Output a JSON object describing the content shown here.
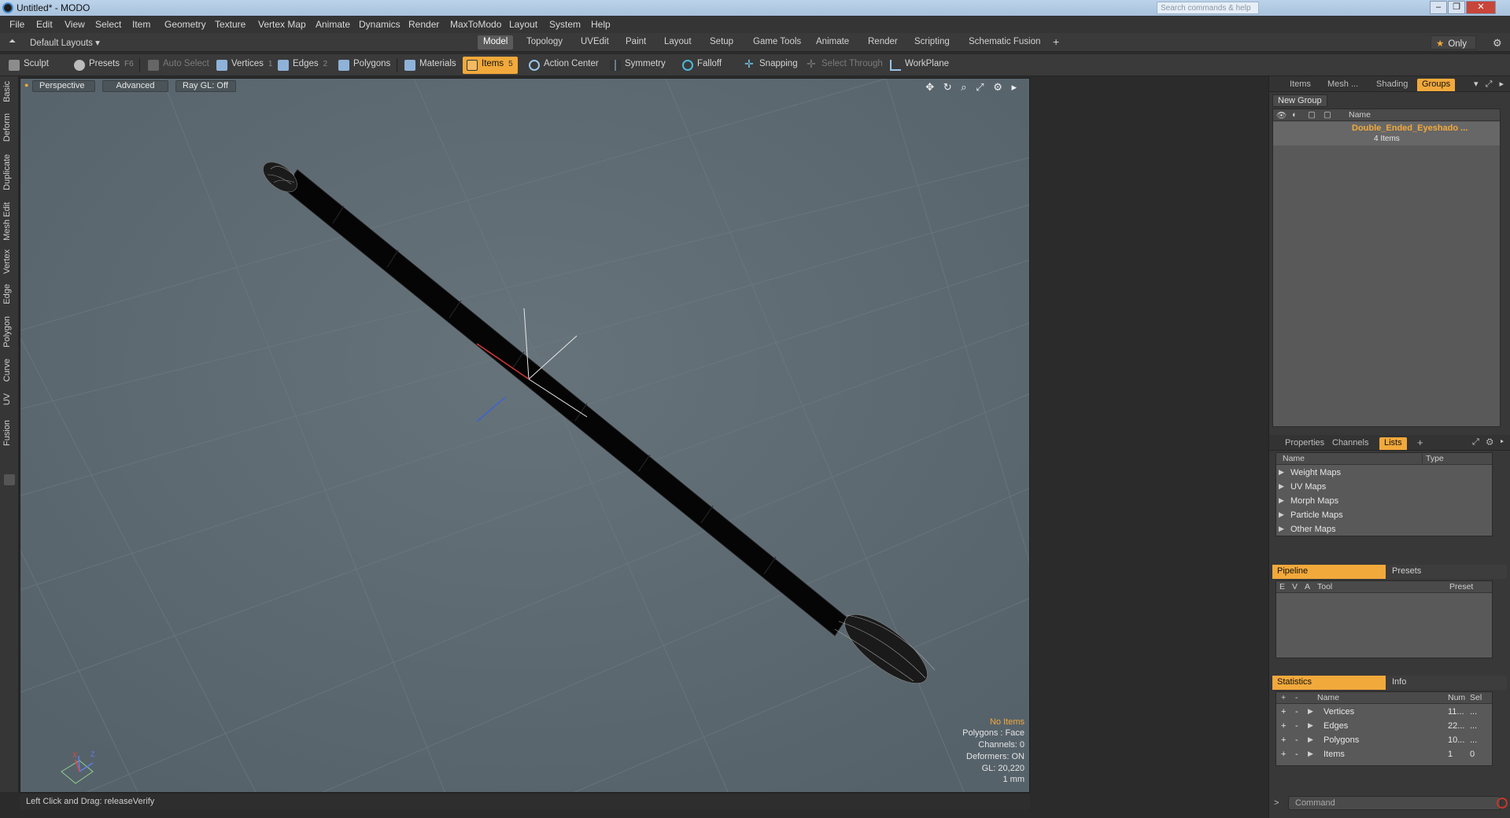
{
  "titlebar": {
    "title": "Untitled* - MODO",
    "search_placeholder": "Search commands & help",
    "min": "–",
    "max": "❐",
    "close": "✕"
  },
  "menu": [
    "File",
    "Edit",
    "View",
    "Select",
    "Item",
    "Geometry",
    "Texture",
    "Vertex Map",
    "Animate",
    "Dynamics",
    "Render",
    "MaxToModo",
    "Layout",
    "System",
    "Help"
  ],
  "layout_row": {
    "layout_selector": "Default Layouts ▾",
    "tabs": [
      "Model",
      "Topology",
      "UVEdit",
      "Paint",
      "Layout",
      "Setup",
      "Game Tools",
      "Animate",
      "Render",
      "Scripting",
      "Schematic Fusion"
    ],
    "active_tab": "Model",
    "add_tab": "+",
    "only_label": "Only",
    "gear": "⚙"
  },
  "toolbar": {
    "sculpt": "Sculpt",
    "presets": "Presets",
    "presets_key": "F6",
    "auto_select": "Auto Select",
    "vertices": "Vertices",
    "vertices_key": "1",
    "edges": "Edges",
    "edges_key": "2",
    "polygons": "Polygons",
    "materials": "Materials",
    "items": "Items",
    "items_key": "5",
    "action_center": "Action Center",
    "symmetry": "Symmetry",
    "falloff": "Falloff",
    "snapping": "Snapping",
    "select_through": "Select Through",
    "workplane": "WorkPlane"
  },
  "left_tabs": [
    "Basic",
    "Deform",
    "Duplicate",
    "Mesh Edit",
    "Vertex",
    "Edge",
    "Polygon",
    "Curve",
    "UV",
    "Fusion"
  ],
  "viewport": {
    "view_mode": "Perspective",
    "shading": "Advanced",
    "raygl": "Ray GL: Off",
    "icons": "✥ ↻ ⌕ ⤢ ⚙ ▸",
    "info": {
      "selection": "No Items",
      "polygons": "Polygons : Face",
      "channels": "Channels: 0",
      "deformers": "Deformers: ON",
      "gl": "GL: 20,220",
      "unit": "1 mm"
    },
    "axis_labels": {
      "x": "X",
      "z": "Z"
    }
  },
  "statusbar": {
    "text": "Left Click and Drag:  releaseVerify"
  },
  "groups_panel": {
    "tabs": [
      "Items",
      "Mesh ...",
      "Shading",
      "Groups"
    ],
    "active_tab": "Groups",
    "new_group": "New Group",
    "col_name": "Name",
    "group_name": "Double_Ended_Eyeshado ...",
    "group_count": "4 Items"
  },
  "lists_panel": {
    "tabs": [
      "Properties",
      "Channels",
      "Lists"
    ],
    "active_tab": "Lists",
    "add": "+",
    "col_name": "Name",
    "col_type": "Type",
    "items": [
      "Weight Maps",
      "UV Maps",
      "Morph Maps",
      "Particle Maps",
      "Other Maps"
    ]
  },
  "pipeline_panel": {
    "tabs": [
      "Pipeline",
      "Presets"
    ],
    "active_tab": "Pipeline",
    "cols": {
      "e": "E",
      "v": "V",
      "a": "A",
      "tool": "Tool",
      "preset": "Preset"
    }
  },
  "statistics_panel": {
    "tabs": [
      "Statistics",
      "Info"
    ],
    "active_tab": "Statistics",
    "cols": {
      "plus": "+",
      "minus": "-",
      "name": "Name",
      "num": "Num",
      "sel": "Sel"
    },
    "rows": [
      {
        "name": "Vertices",
        "num": "11...",
        "sel": "..."
      },
      {
        "name": "Edges",
        "num": "22...",
        "sel": "..."
      },
      {
        "name": "Polygons",
        "num": "10...",
        "sel": "..."
      },
      {
        "name": "Items",
        "num": "1",
        "sel": "0"
      }
    ]
  },
  "command": {
    "placeholder": "Command"
  },
  "colors": {
    "accent": "#f2a93b",
    "viewport_bg": "#5e6b72",
    "panel_bg": "#383838"
  }
}
